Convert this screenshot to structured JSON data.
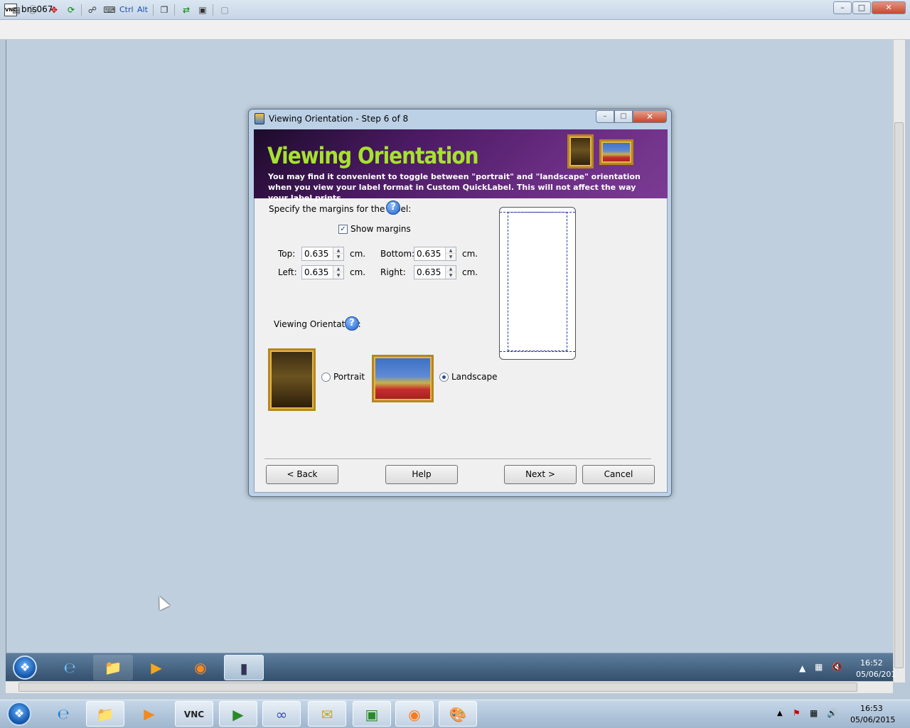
{
  "vnc": {
    "title": "bns067",
    "logo_text": "VNC",
    "toolbar": {
      "ctrl_label": "Ctrl",
      "alt_label": "Alt"
    }
  },
  "dialog": {
    "title": "Viewing Orientation - Step 6 of 8",
    "banner_title": "Viewing Orientation",
    "banner_text": "You may find it convenient to toggle between \"portrait\" and \"landscape\" orientation when you view your label format in Custom QuickLabel. This will not affect the way your label prints.",
    "margins_label": "Specify the margins for the label:",
    "show_margins_label": "Show margins",
    "show_margins_checked": true,
    "top_label": "Top:",
    "top_value": "0.635",
    "bottom_label": "Bottom:",
    "bottom_value": "0.635",
    "left_label": "Left:",
    "left_value": "0.635",
    "right_label": "Right:",
    "right_value": "0.635",
    "unit": "cm.",
    "orientation_label": "Viewing Orientation:",
    "portrait_label": "Portrait",
    "landscape_label": "Landscape",
    "selected_orientation": "Landscape",
    "back_label": "< Back",
    "help_label": "Help",
    "next_label": "Next >",
    "cancel_label": "Cancel",
    "help_glyph": "?"
  },
  "remote_taskbar": {
    "time": "16:52",
    "date": "05/06/201"
  },
  "local_taskbar": {
    "time": "16:53",
    "date": "05/06/2015"
  },
  "colors": {
    "banner_title": "#a6e22e",
    "banner_bg": "#4b1a63",
    "desktop": "#c0cfdd"
  }
}
